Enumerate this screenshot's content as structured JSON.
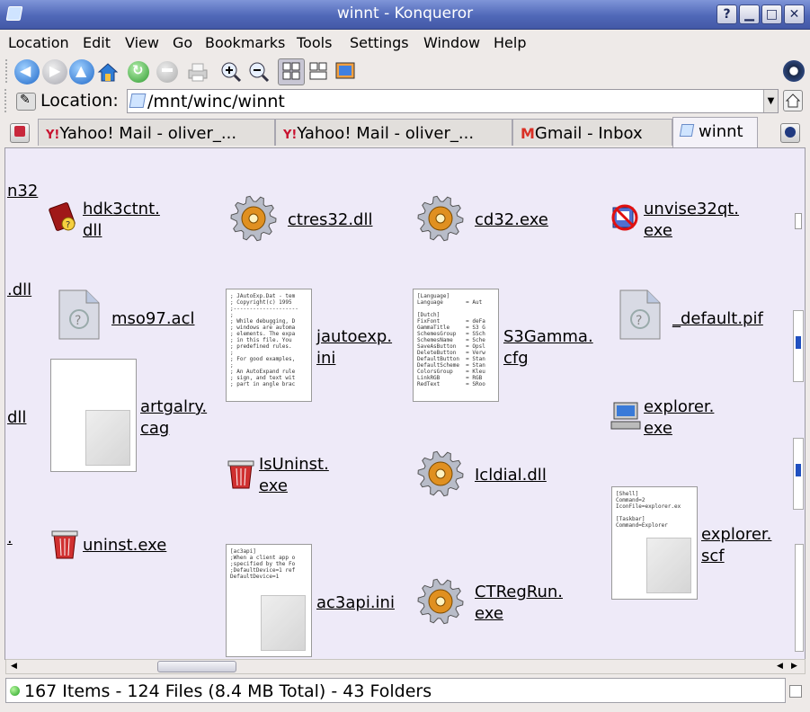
{
  "window": {
    "title": "winnt - Konqueror",
    "buttons": [
      "?",
      "▁",
      "□",
      "✕"
    ]
  },
  "menu": [
    "Location",
    "Edit",
    "View",
    "Go",
    "Bookmarks",
    "Tools",
    "Settings",
    "Window",
    "Help"
  ],
  "toolbar_icons": [
    "back-icon",
    "forward-icon",
    "up-icon",
    "home-icon",
    "reload-icon",
    "stop-icon",
    "print-icon",
    "zoom-in-icon",
    "zoom-out-icon",
    "view-mode-icon",
    "view-mode-2-icon",
    "preview-icon"
  ],
  "location": {
    "label": "Location:",
    "value": "/mnt/winc/winnt"
  },
  "tabs": [
    "Yahoo! Mail - oliver_...",
    "Yahoo! Mail - oliver_...",
    "Gmail - Inbox",
    "winnt"
  ],
  "partial_labels": [
    "n32",
    ".dll",
    "dll",
    "."
  ],
  "files": [
    {
      "l1": "hdk3ctnt.",
      "l2": "dll"
    },
    {
      "l1": "ctres32.dll",
      "l2": ""
    },
    {
      "l1": "cd32.exe",
      "l2": ""
    },
    {
      "l1": "unvise32qt.",
      "l2": "exe"
    },
    {
      "l1": "mso97.acl",
      "l2": ""
    },
    {
      "l1": "jautoexp.",
      "l2": "ini"
    },
    {
      "l1": "S3Gamma.",
      "l2": "cfg"
    },
    {
      "l1": "_default.pif",
      "l2": ""
    },
    {
      "l1": "artgalry.",
      "l2": "cag"
    },
    {
      "l1": "explorer.",
      "l2": "exe"
    },
    {
      "l1": "IsUninst.",
      "l2": "exe"
    },
    {
      "l1": "Icldial.dll",
      "l2": ""
    },
    {
      "l1": "uninst.exe",
      "l2": ""
    },
    {
      "l1": "explorer.",
      "l2": "scf"
    },
    {
      "l1": "ac3api.ini",
      "l2": ""
    },
    {
      "l1": "CTRegRun.",
      "l2": "exe"
    }
  ],
  "previews": {
    "jautoexp": "; JAutoExp.Dat - tem\n; Copyright(c) 1995\n;--------------------\n;\n; While debugging, D\n; windows are automa\n; elements. The expa\n; in this file. You\n; predefined rules.\n;\n; For good examples,\n;\n; An AutoExpand rule\n; sign, and text wit\n; part in angle brac",
    "s3gamma": "[Language]\nLanguage       = Aut\n\n[Dutch]\nFixFont        = deFa\nGammaTitle     = S3 G\nSchemesGroup   = SSch\nSchemesName    = Sche\nSaveAsButton   = Opsl\nDeleteButton   = Verw\nDefaultButton  = Stan\nDefaultScheme  = Stan\nColorsGroup    = Kleu\nLinkRGB        = RGB\nRedText        = SRoo",
    "explorer_scf": "[Shell]\nCommand=2\nIconFile=explorer.ex\n\n[Taskbar]\nCommand=Explorer",
    "ac3api": "[ac3api]\n;When a client app o\n;specified by the Fo\n;DefaultDevice=1 ref\nDefaultDevice=1"
  },
  "status": {
    "text": "167 Items - 124 Files (8.4 MB Total) - 43 Folders"
  },
  "colors": {
    "titlebar": "#5068b8",
    "view_bg": "#eeeaf8",
    "gear": "#e09020"
  }
}
